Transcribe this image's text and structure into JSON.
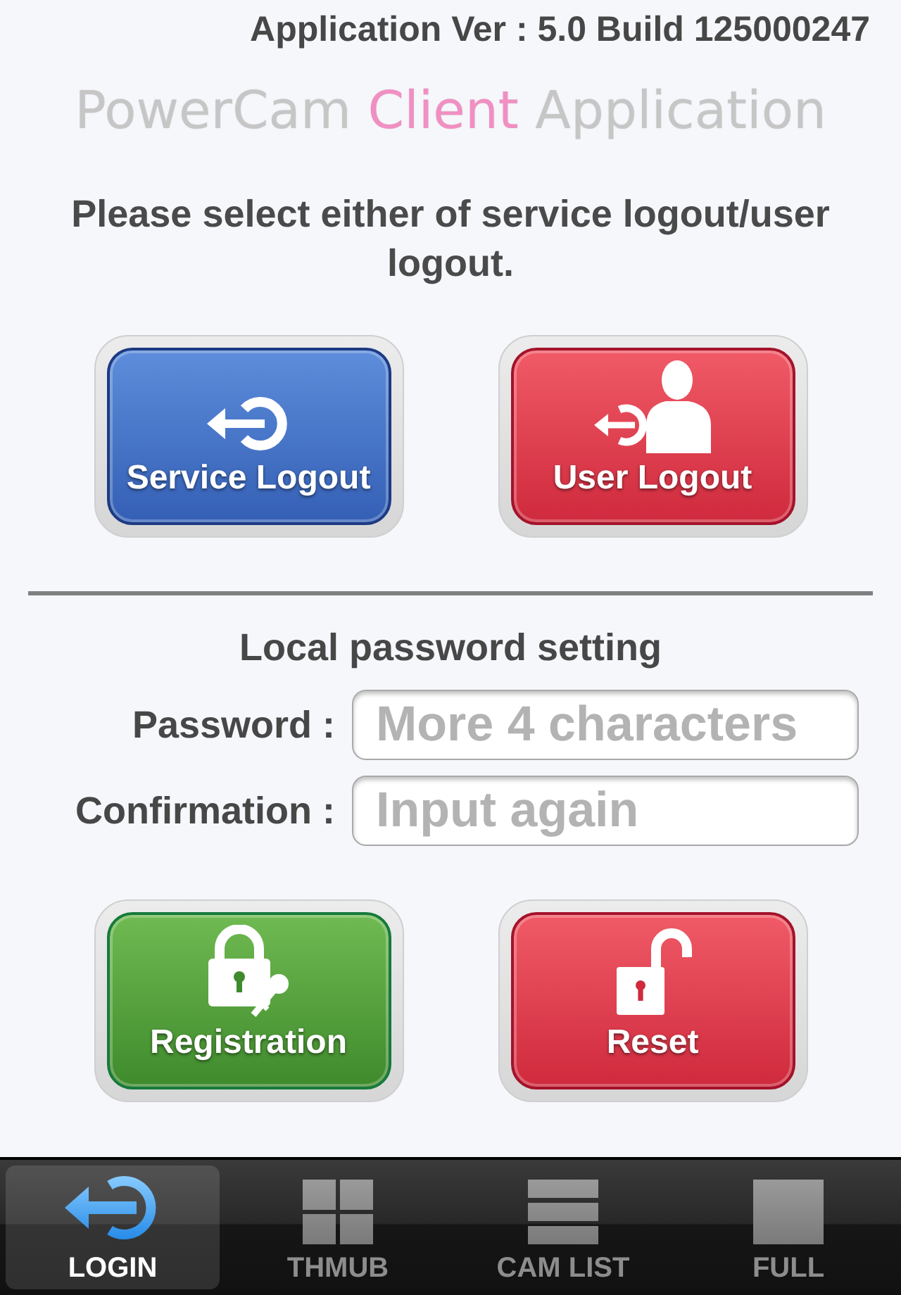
{
  "header": {
    "version": "Application Ver : 5.0 Build 125000247"
  },
  "title": {
    "parts": [
      {
        "text": "PowerCam",
        "color": "#c6c6c6"
      },
      {
        "text": "Client",
        "color": "#f08fc2"
      },
      {
        "text": "Application",
        "color": "#c6c6c6"
      }
    ]
  },
  "instruction": "Please select either of service logout/user logout.",
  "logout_buttons": [
    {
      "label": "Service Logout",
      "kind": "service"
    },
    {
      "label": "User Logout",
      "kind": "user"
    }
  ],
  "password_section": {
    "heading": "Local password setting",
    "fields": [
      {
        "label": "Password :",
        "placeholder": "More 4 characters"
      },
      {
        "label": "Confirmation :",
        "placeholder": "Input again"
      }
    ],
    "buttons": [
      {
        "label": "Registration",
        "kind": "register"
      },
      {
        "label": "Reset",
        "kind": "reset"
      }
    ]
  },
  "tab_bar": {
    "tabs": [
      {
        "label": "LOGIN",
        "kind": "login",
        "selected": true
      },
      {
        "label": "THMUB",
        "kind": "thumb",
        "selected": false
      },
      {
        "label": "CAM LIST",
        "kind": "list",
        "selected": false
      },
      {
        "label": "FULL",
        "kind": "full",
        "selected": false
      }
    ]
  }
}
